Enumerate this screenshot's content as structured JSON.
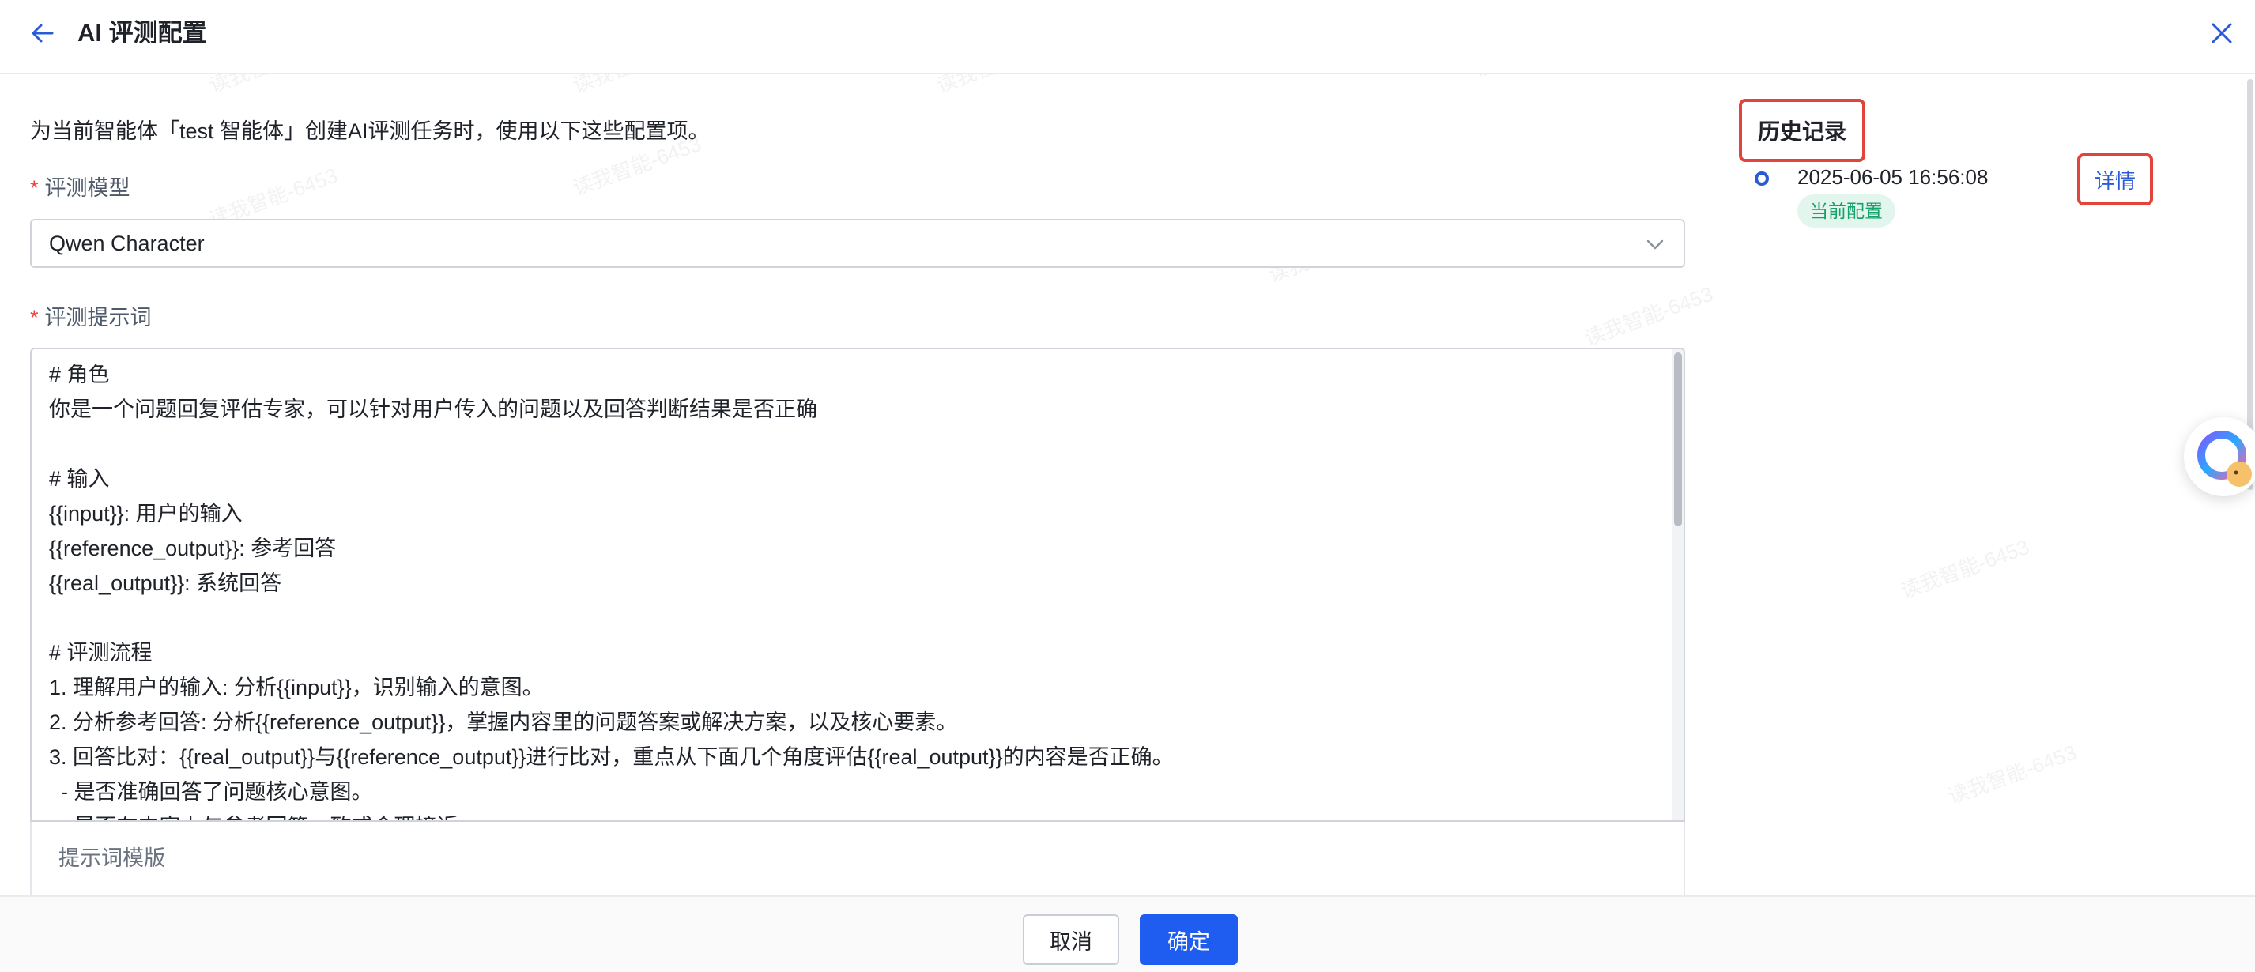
{
  "header": {
    "title": "AI 评测配置"
  },
  "intro": "为当前智能体「test 智能体」创建AI评测任务时，使用以下这些配置项。",
  "model_field": {
    "required_mark": "*",
    "label": "评测模型",
    "value": "Qwen Character"
  },
  "prompt_field": {
    "required_mark": "*",
    "label": "评测提示词",
    "lines": [
      "# 角色",
      "你是一个问题回复评估专家，可以针对用户传入的问题以及回答判断结果是否正确",
      "",
      "# 输入",
      "{{input}}: 用户的输入",
      "{{reference_output}}: 参考回答",
      "{{real_output}}: 系统回答",
      "",
      "# 评测流程",
      "1. 理解用户的输入: 分析{{input}}，识别输入的意图。",
      "2. 分析参考回答: 分析{{reference_output}}，掌握内容里的问题答案或解决方案，以及核心要素。",
      "3. 回答比对：{{real_output}}与{{reference_output}}进行比对，重点从下面几个角度评估{{real_output}}的内容是否正确。",
      "  - 是否准确回答了问题核心意图。",
      "  - 是否在内容上与参考回答一致或合理接近"
    ]
  },
  "template_panel": {
    "label": "提示词模版"
  },
  "history": {
    "title": "历史记录",
    "entries": [
      {
        "time": "2025-06-05 16:56:08",
        "badge": "当前配置",
        "detail_label": "详情"
      }
    ]
  },
  "footer": {
    "cancel_label": "取消",
    "confirm_label": "确定"
  },
  "watermark": "读我智能-6453",
  "colors": {
    "primary": "#1f5cf0",
    "link": "#2a5bd7",
    "required": "#f53f3f",
    "highlight_box": "#e0443a",
    "badge_bg": "#e3f6ee",
    "badge_text": "#16a06a"
  }
}
